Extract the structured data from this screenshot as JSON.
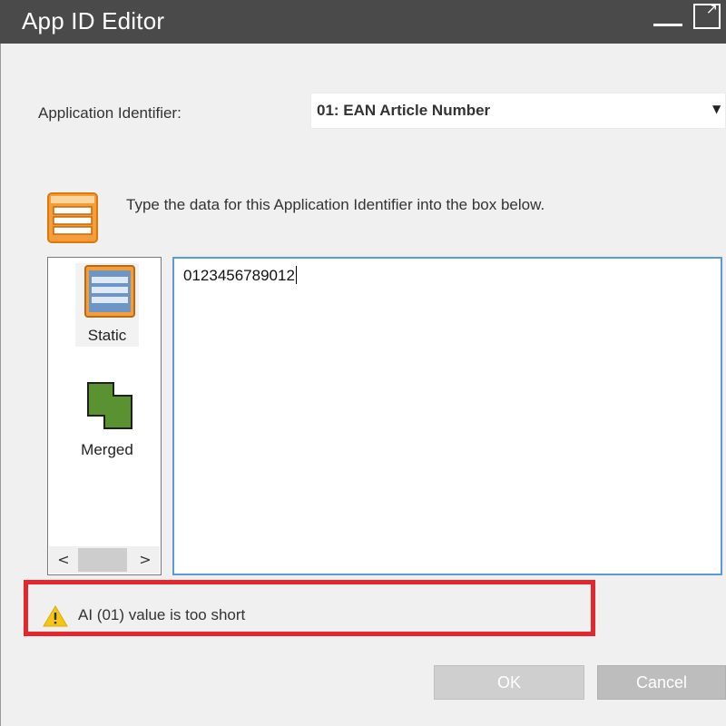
{
  "window": {
    "title": "App ID Editor",
    "minimize_icon": "minimize-icon",
    "maximize_icon": "maximize-icon"
  },
  "form": {
    "ai_label": "Application Identifier:",
    "ai_selected": "01: EAN Article Number",
    "instruction": "Type the data for this Application Identifier into the box below."
  },
  "palette": {
    "items": [
      {
        "label": "Static",
        "icon": "static-data-icon"
      },
      {
        "label": "Merged",
        "icon": "merged-data-icon"
      }
    ],
    "scroll_left_icon": "chevron-left-icon",
    "scroll_right_icon": "chevron-right-icon"
  },
  "data_box": {
    "value": "0123456789012"
  },
  "status": {
    "warning": "AI (01) value is too short",
    "icon": "warning-icon",
    "highlight_color": "#e5262d"
  },
  "buttons": {
    "ok": "OK",
    "cancel": "Cancel"
  }
}
